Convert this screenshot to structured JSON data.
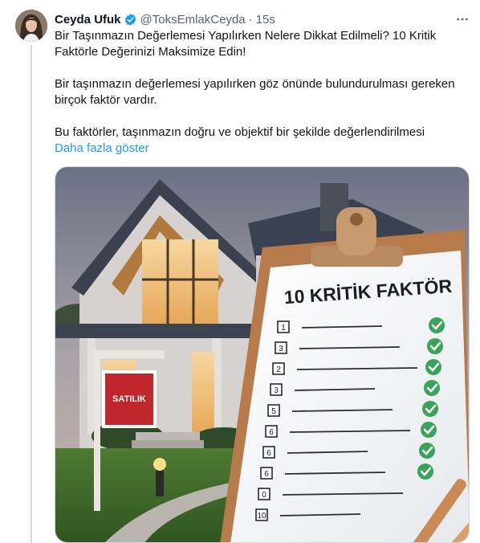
{
  "tweet": {
    "author_name": "Ceyda Ufuk",
    "handle": "@ToksEmlakCeyda",
    "separator": "·",
    "time": "15s",
    "text_line1": "Bir Taşınmazın Değerlemesi Yapılırken Nelere Dikkat Edilmeli? 10 Kritik Faktörle Değerinizi Maksimize Edin!",
    "text_line2": "Bir taşınmazın değerlemesi yapılırken göz önünde bulundurulması gereken birçok faktör vardır.",
    "text_line3": "Bu faktörler, taşınmazın doğru ve objektif bir şekilde değerlendirilmesi",
    "show_more": "Daha fazla göster"
  },
  "media": {
    "sign_text": "SATILIK",
    "clipboard_title": "10 KRİTİK FAKTÖR",
    "numbers": [
      "1",
      "3",
      "2",
      "3",
      "5",
      "6",
      "6",
      "6",
      "0",
      "10"
    ]
  },
  "colors": {
    "accent": "#1d9bf0",
    "text": "#0f1419",
    "muted": "#536471",
    "check_green": "#3aa35a",
    "sign_red": "#c0272d"
  },
  "icons": [
    "verified-badge-icon",
    "more-options-icon"
  ]
}
